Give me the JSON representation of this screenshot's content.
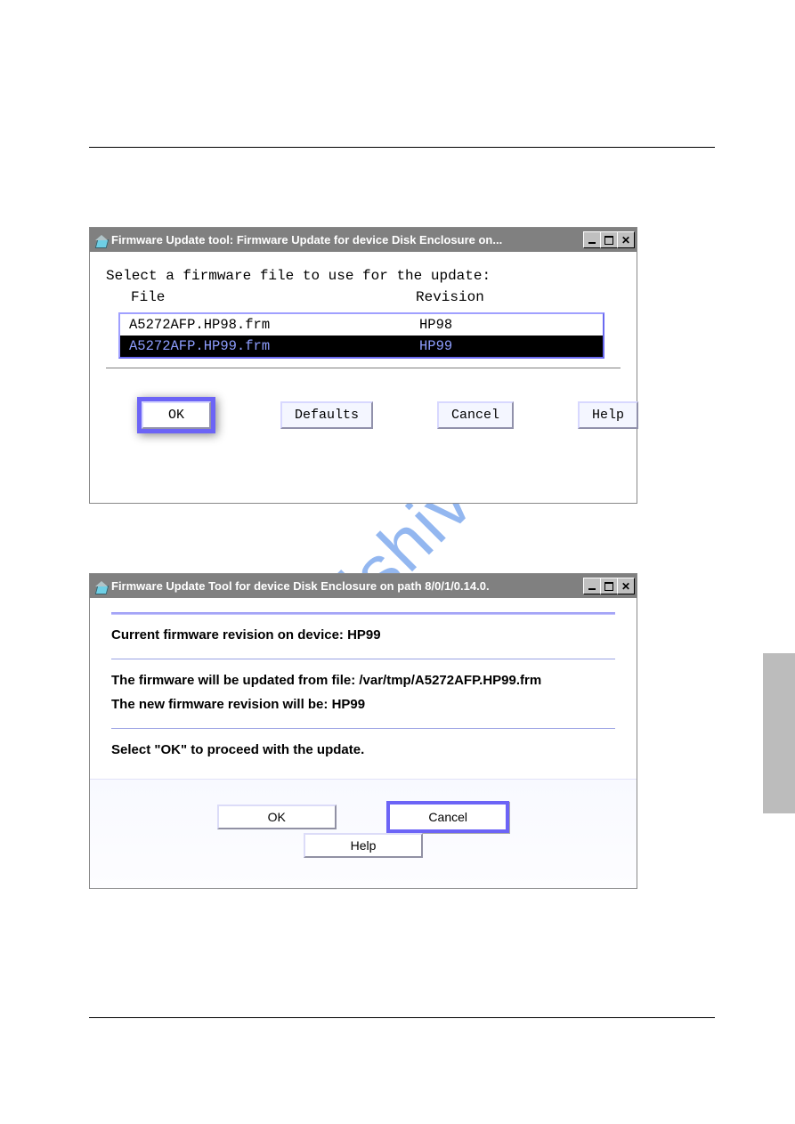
{
  "watermark": "manualshive.com",
  "dialog1": {
    "title": "Firmware Update tool: Firmware Update for device Disk Enclosure on...",
    "prompt": "Select a firmware file to use for the update:",
    "headers": {
      "file": "File",
      "revision": "Revision"
    },
    "rows": [
      {
        "file": "A5272AFP.HP98.frm",
        "revision": "HP98",
        "selected": false
      },
      {
        "file": "A5272AFP.HP99.frm",
        "revision": "HP99",
        "selected": true
      }
    ],
    "buttons": {
      "ok": "OK",
      "defaults": "Defaults",
      "cancel": "Cancel",
      "help": "Help"
    }
  },
  "dialog2": {
    "title": "Firmware Update Tool for device Disk Enclosure on path 8/0/1/0.14.0.",
    "lines": {
      "current": "Current firmware revision on device: HP99",
      "fromfile": "The firmware will be updated from file: /var/tmp/A5272AFP.HP99.frm",
      "newrev": "The new firmware revision will be: HP99",
      "proceed": "Select \"OK\" to proceed with the update."
    },
    "buttons": {
      "ok": "OK",
      "cancel": "Cancel",
      "help": "Help"
    }
  }
}
